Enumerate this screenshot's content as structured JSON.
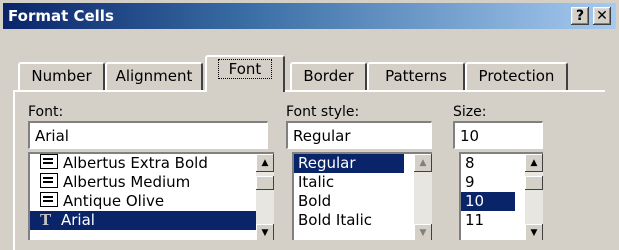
{
  "window": {
    "title": "Format Cells",
    "help_label": "?",
    "close_label": "✕"
  },
  "tabs": [
    "Number",
    "Alignment",
    "Font",
    "Border",
    "Patterns",
    "Protection"
  ],
  "active_tab": "Font",
  "font": {
    "label": "Font:",
    "value": "Arial",
    "items": [
      "Albertus Extra Bold",
      "Albertus Medium",
      "Antique Olive",
      "Arial"
    ],
    "selected": "Arial",
    "item_icons": [
      "printer-font-icon",
      "printer-font-icon",
      "printer-font-icon",
      "truetype-font-icon"
    ]
  },
  "style": {
    "label": "Font style:",
    "value": "Regular",
    "items": [
      "Regular",
      "Italic",
      "Bold",
      "Bold Italic"
    ],
    "selected": "Regular"
  },
  "size": {
    "label": "Size:",
    "value": "10",
    "items": [
      "8",
      "9",
      "10",
      "11"
    ],
    "selected": "10"
  },
  "colors": {
    "title_start": "#0a246a",
    "title_end": "#a6caf0",
    "selection": "#0a246a",
    "face": "#d4d0c8"
  }
}
